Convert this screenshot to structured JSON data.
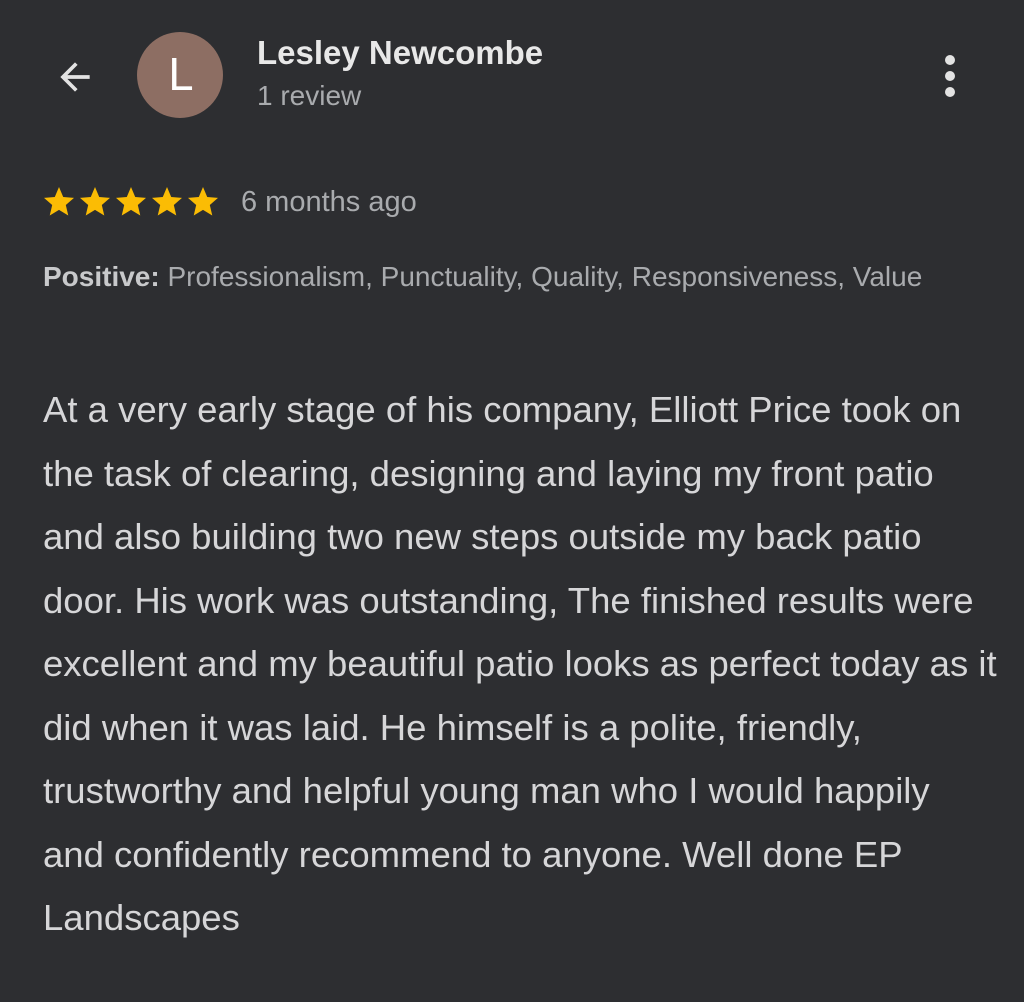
{
  "header": {
    "back_icon": "arrow-left-icon",
    "avatar_initial": "L",
    "avatar_color": "#8d6e63",
    "reviewer_name": "Lesley Newcombe",
    "review_count": "1 review",
    "more_icon": "more-vert-icon"
  },
  "rating": {
    "stars": 5,
    "max_stars": 5,
    "star_color": "#fbbc04",
    "time_ago": "6 months ago"
  },
  "attributes": {
    "label": "Positive:",
    "values": "Professionalism, Punctuality, Quality, Responsiveness, Value"
  },
  "review": {
    "text": "At a very early stage of his company, Elliott Price took on the task of clearing, designing and laying my front patio and also building two new steps outside my back patio door. His work was outstanding, The finished results were excellent and my beautiful patio looks as perfect today as it did when it was laid. He himself is a polite, friendly, trustworthy and helpful young man who I would happily and confidently recommend to anyone. Well done EP Landscapes"
  }
}
